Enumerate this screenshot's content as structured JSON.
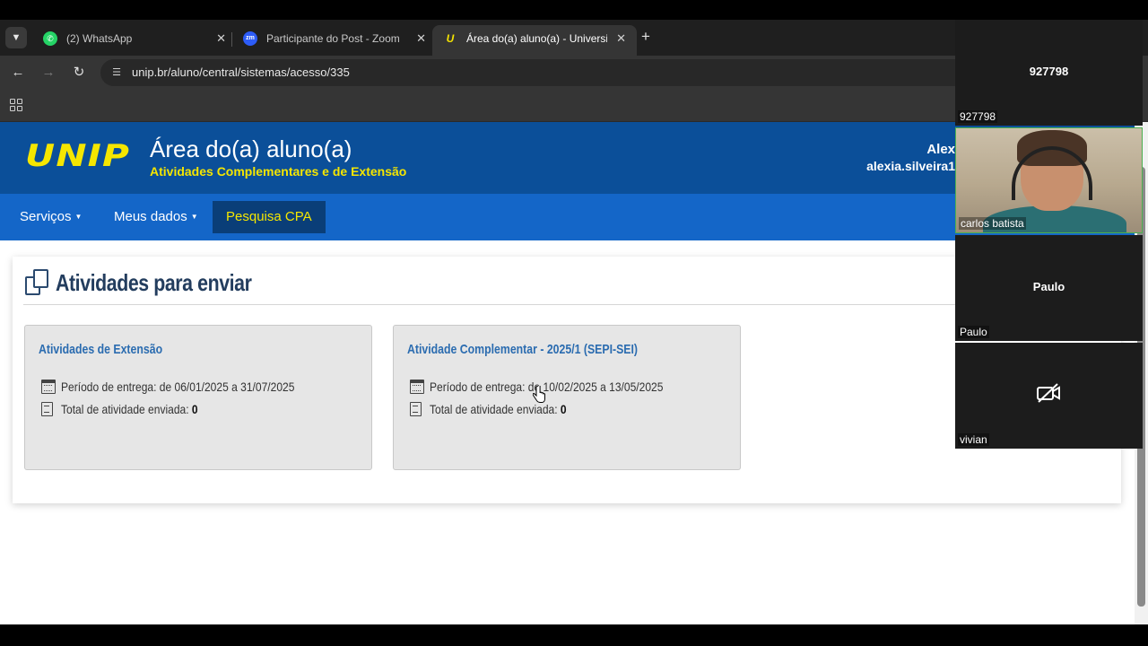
{
  "browser": {
    "tabs": [
      {
        "title": "(2) WhatsApp",
        "icon": "whatsapp-icon",
        "active": false
      },
      {
        "title": "Participante do Post - Zoom",
        "icon": "zoom-icon",
        "active": false
      },
      {
        "title": "Área do(a) aluno(a) - Universid",
        "icon": "unip-icon",
        "active": true
      }
    ],
    "url": "unip.br/aluno/central/sistemas/acesso/335"
  },
  "header": {
    "logo": "UNIP",
    "title": "Área do(a) aluno(a)",
    "subtitle": "Atividades Complementares e de Extensão",
    "user_name": "Alex",
    "user_email": "alexia.silveira1"
  },
  "nav": {
    "items": [
      {
        "label": "Serviços",
        "dropdown": true
      },
      {
        "label": "Meus dados",
        "dropdown": true
      },
      {
        "label": "Pesquisa CPA",
        "dropdown": false
      }
    ]
  },
  "panel": {
    "heading": "Atividades para enviar",
    "cards": [
      {
        "title": "Atividades de Extensão",
        "period_label": "Período de entrega: de 06/01/2025 a 31/07/2025",
        "total_label": "Total de atividade enviada:",
        "total_value": "0"
      },
      {
        "title": "Atividade Complementar - 2025/1 (SEPI-SEI)",
        "period_label": "Período de entrega: de 10/02/2025 a 13/05/2025",
        "total_label": "Total de atividade enviada:",
        "total_value": "0"
      }
    ]
  },
  "zoom": {
    "participants": [
      {
        "center_label": "927798",
        "name": "927798",
        "video": false
      },
      {
        "center_label": "",
        "name": "carlos batista",
        "video": true
      },
      {
        "center_label": "Paulo",
        "name": "Paulo",
        "video": false
      },
      {
        "center_label": "",
        "name": "vivian",
        "video": false,
        "camera_off": true
      }
    ]
  },
  "colors": {
    "header_bg": "#0b4f99",
    "nav_bg": "#1466c8",
    "accent_yellow": "#f5e600",
    "heading_text": "#233d5e",
    "card_title": "#2b6cb0"
  }
}
